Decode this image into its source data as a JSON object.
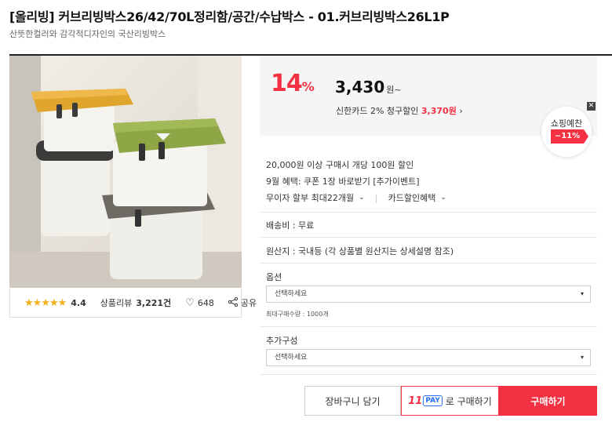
{
  "product": {
    "title": "[올리빙] 커브리빙박스26/42/70L정리함/공간/수납박스 - 01.커브리빙박스26L1P",
    "subtitle": "산뜻한컬러와 감각적디자인의 국산리빙박스"
  },
  "rating": {
    "stars": "★★★★★",
    "score": "4.4",
    "review_label": "상품리뷰",
    "review_count": "3,221건",
    "likes": "648",
    "share_label": "공유"
  },
  "price": {
    "discount_rate": "14",
    "discount_unit": "%",
    "amount": "3,430",
    "unit": "원~",
    "card_text": "신한카드 2% 청구할인",
    "card_price": "3,370원",
    "card_arrow": "›"
  },
  "shopping_badge": {
    "title": "쇼핑예찬",
    "value": "~11%",
    "close": "✕"
  },
  "benefits": {
    "line1": "20,000원 이상 구매시 개당 100원 할인",
    "line2": "9월 혜택: 쿠폰 1장 바로받기 [추가이벤트]",
    "installment": "무이자 할부 최대22개월",
    "card_benefit": "카드할인혜택"
  },
  "shipping": "배송비 : 무료",
  "origin": "원산지 : 국내등 (각 상품별 원산지는 상세설명 참조)",
  "option": {
    "label": "옵션",
    "placeholder": "선택하세요",
    "max_qty": "최대구매수량 : 1000개"
  },
  "addon": {
    "label": "추가구성",
    "placeholder": "선택하세요"
  },
  "buttons": {
    "cart": "장바구니 담기",
    "pay_11": "11",
    "pay_word": "PAY",
    "pay_suffix": "로 구매하기",
    "buy": "구매하기"
  },
  "icons": {
    "heart": "heart-icon",
    "share": "share-icon",
    "chevron": "chevron-down-icon",
    "caret": "caret-down-icon"
  },
  "colors": {
    "accent": "#f43142",
    "pay_blue": "#2b6df5",
    "star": "#f2b01e"
  }
}
